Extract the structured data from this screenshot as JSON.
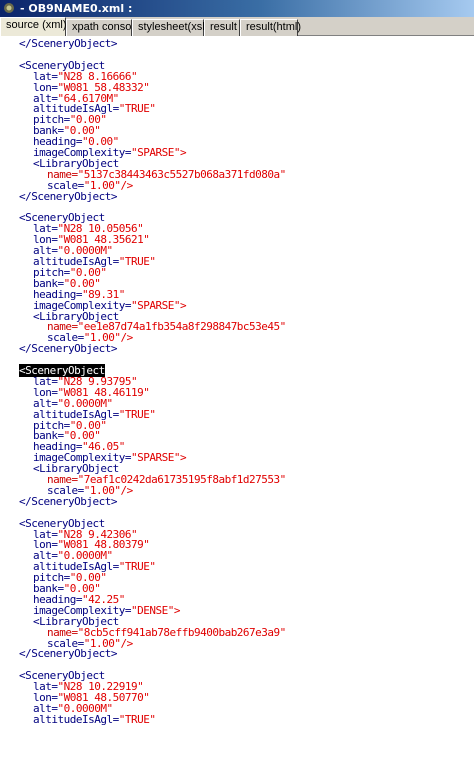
{
  "window": {
    "title": "- OB9NAME0.xml :"
  },
  "tabs": [
    {
      "label": "source (xml)",
      "active": true
    },
    {
      "label": "xpath console",
      "active": false
    },
    {
      "label": "stylesheet(xsl)",
      "active": false
    },
    {
      "label": "result",
      "active": false
    },
    {
      "label": "result(html)",
      "active": false
    }
  ],
  "editor": {
    "close_line": "</SceneryObject>",
    "objects": [
      {
        "open_tag": "<SceneryObject",
        "lat_key": "lat=",
        "lat": "\"N28 8.16666\"",
        "lon_key": "lon=",
        "lon": "\"W081 58.48332\"",
        "alt_key": "alt=",
        "alt": "\"64.6170M\"",
        "agl_key": "altitudeIsAgl=",
        "agl": "\"TRUE\"",
        "pitch_key": "pitch=",
        "pitch": "\"0.00\"",
        "bank_key": "bank=",
        "bank": "\"0.00\"",
        "heading_key": "heading=",
        "heading": "\"0.00\"",
        "complexity_key": "imageComplexity=",
        "complexity": "\"SPARSE\">",
        "lib_tag": "<LibraryObject",
        "name_key": "name=",
        "name": "\"5137c38443463c5527b068a371fd080a\"",
        "scale_key": "scale=",
        "scale": "\"1.00\"/>",
        "close_tag": "</SceneryObject>"
      },
      {
        "open_tag": "<SceneryObject",
        "lat_key": "lat=",
        "lat": "\"N28 10.05056\"",
        "lon_key": "lon=",
        "lon": "\"W081 48.35621\"",
        "alt_key": "alt=",
        "alt": "\"0.0000M\"",
        "agl_key": "altitudeIsAgl=",
        "agl": "\"TRUE\"",
        "pitch_key": "pitch=",
        "pitch": "\"0.00\"",
        "bank_key": "bank=",
        "bank": "\"0.00\"",
        "heading_key": "heading=",
        "heading": "\"89.31\"",
        "complexity_key": "imageComplexity=",
        "complexity": "\"SPARSE\">",
        "lib_tag": "<LibraryObject",
        "name_key": "name=",
        "name": "\"ee1e87d74a1fb354a8f298847bc53e45\"",
        "scale_key": "scale=",
        "scale": "\"1.00\"/>",
        "close_tag": "</SceneryObject>"
      },
      {
        "open_tag": "<SceneryObject",
        "lat_key": "lat=",
        "lat": "\"N28 9.93795\"",
        "lon_key": "lon=",
        "lon": "\"W081 48.46119\"",
        "alt_key": "alt=",
        "alt": "\"0.0000M\"",
        "agl_key": "altitudeIsAgl=",
        "agl": "\"TRUE\"",
        "pitch_key": "pitch=",
        "pitch": "\"0.00\"",
        "bank_key": "bank=",
        "bank": "\"0.00\"",
        "heading_key": "heading=",
        "heading": "\"46.05\"",
        "complexity_key": "imageComplexity=",
        "complexity": "\"SPARSE\">",
        "lib_tag": "<LibraryObject",
        "name_key": "name=",
        "name": "\"7eaf1c0242da61735195f8abf1d27553\"",
        "scale_key": "scale=",
        "scale": "\"1.00\"/>",
        "close_tag": "</SceneryObject>"
      },
      {
        "open_tag": "<SceneryObject",
        "lat_key": "lat=",
        "lat": "\"N28 9.42306\"",
        "lon_key": "lon=",
        "lon": "\"W081 48.80379\"",
        "alt_key": "alt=",
        "alt": "\"0.0000M\"",
        "agl_key": "altitudeIsAgl=",
        "agl": "\"TRUE\"",
        "pitch_key": "pitch=",
        "pitch": "\"0.00\"",
        "bank_key": "bank=",
        "bank": "\"0.00\"",
        "heading_key": "heading=",
        "heading": "\"42.25\"",
        "complexity_key": "imageComplexity=",
        "complexity": "\"DENSE\">",
        "lib_tag": "<LibraryObject",
        "name_key": "name=",
        "name": "\"8cb5cff941ab78effb9400bab267e3a9\"",
        "scale_key": "scale=",
        "scale": "\"1.00\"/>",
        "close_tag": "</SceneryObject>"
      },
      {
        "open_tag": "<SceneryObject",
        "lat_key": "lat=",
        "lat": "\"N28 10.22919\"",
        "lon_key": "lon=",
        "lon": "\"W081 48.50770\"",
        "alt_key": "alt=",
        "alt": "\"0.0000M\"",
        "agl_key": "altitudeIsAgl=",
        "agl": "\"TRUE\""
      }
    ],
    "selected_text": "<SceneryObject"
  }
}
